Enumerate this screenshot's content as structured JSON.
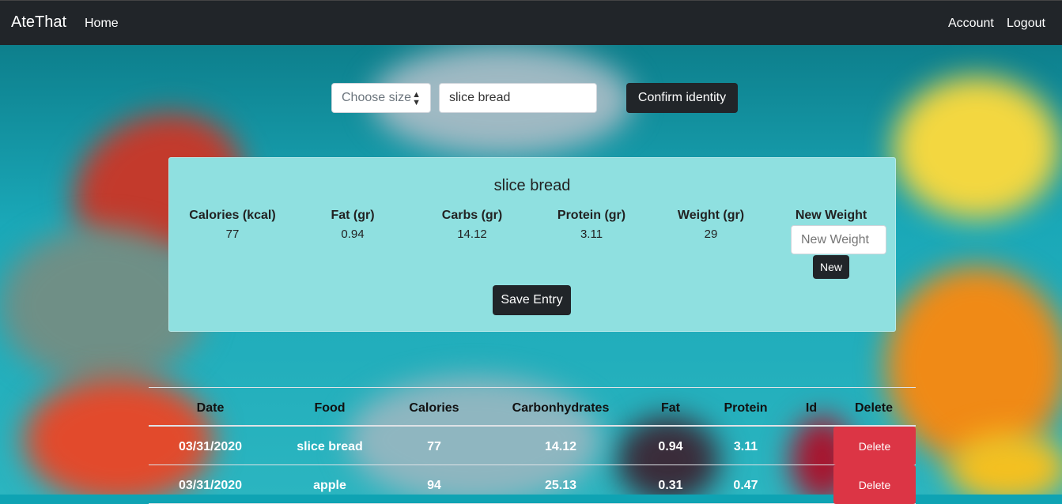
{
  "navbar": {
    "brand": "AteThat",
    "home": "Home",
    "account": "Account",
    "logout": "Logout"
  },
  "search_bar": {
    "size_select": "Choose size",
    "food_input_value": "slice bread",
    "confirm_label": "Confirm identity"
  },
  "food_card": {
    "title": "slice bread",
    "calories_label": "Calories (kcal)",
    "calories": "77",
    "fat_label": "Fat (gr)",
    "fat": "0.94",
    "carbs_label": "Carbs (gr)",
    "carbs": "14.12",
    "protein_label": "Protein (gr)",
    "protein": "3.11",
    "weight_label": "Weight (gr)",
    "weight": "29",
    "new_weight_label": "New Weight",
    "new_weight_placeholder": "New Weight",
    "new_button": "New",
    "save_button": "Save Entry"
  },
  "table": {
    "headers": [
      "Date",
      "Food",
      "Calories",
      "Carbonhydrates",
      "Fat",
      "Protein",
      "Id",
      "Delete"
    ],
    "rows": [
      {
        "date": "03/31/2020",
        "food": "slice bread",
        "calories": "77",
        "carbs": "14.12",
        "fat": "0.94",
        "protein": "3.11",
        "id": "",
        "delete": "Delete"
      },
      {
        "date": "03/31/2020",
        "food": "apple",
        "calories": "94",
        "carbs": "25.13",
        "fat": "0.31",
        "protein": "0.47",
        "id": "",
        "delete": "Delete"
      }
    ]
  },
  "colors": {
    "navbar": "#212529",
    "card": "#8fe0e0",
    "delete": "#dc3545",
    "background": "#0fa3b3"
  }
}
